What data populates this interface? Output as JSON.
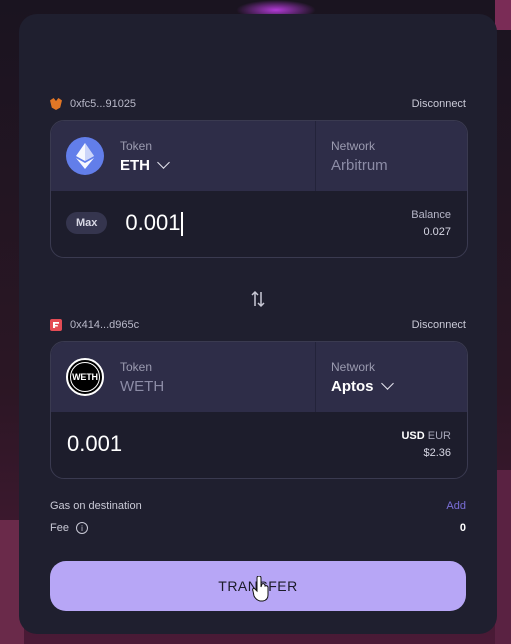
{
  "source_wallet": {
    "address": "0xfc5...91025",
    "disconnect_label": "Disconnect",
    "icon": "metamask-fox-icon"
  },
  "source_card": {
    "token_label": "Token",
    "token_value": "ETH",
    "network_label": "Network",
    "network_value": "Arbitrum",
    "max_label": "Max",
    "amount": "0.001",
    "balance_label": "Balance",
    "balance_value": "0.027"
  },
  "dest_wallet": {
    "address": "0x414...d965c",
    "disconnect_label": "Disconnect",
    "icon": "aptos-wallet-icon"
  },
  "dest_card": {
    "token_label": "Token",
    "token_value": "WETH",
    "token_logo_text": "WETH",
    "network_label": "Network",
    "network_value": "Aptos",
    "amount": "0.001",
    "currency_usd": "USD",
    "currency_eur": "EUR",
    "fiat_value": "$2.36"
  },
  "gas": {
    "label": "Gas on destination",
    "action": "Add"
  },
  "fee": {
    "label": "Fee",
    "value": "0"
  },
  "transfer_label": "TRANSFER",
  "colors": {
    "accent": "#b7a6f6",
    "panel": "#1f1f2f",
    "card_header": "#2e2d48",
    "link": "#7a6fd8"
  }
}
